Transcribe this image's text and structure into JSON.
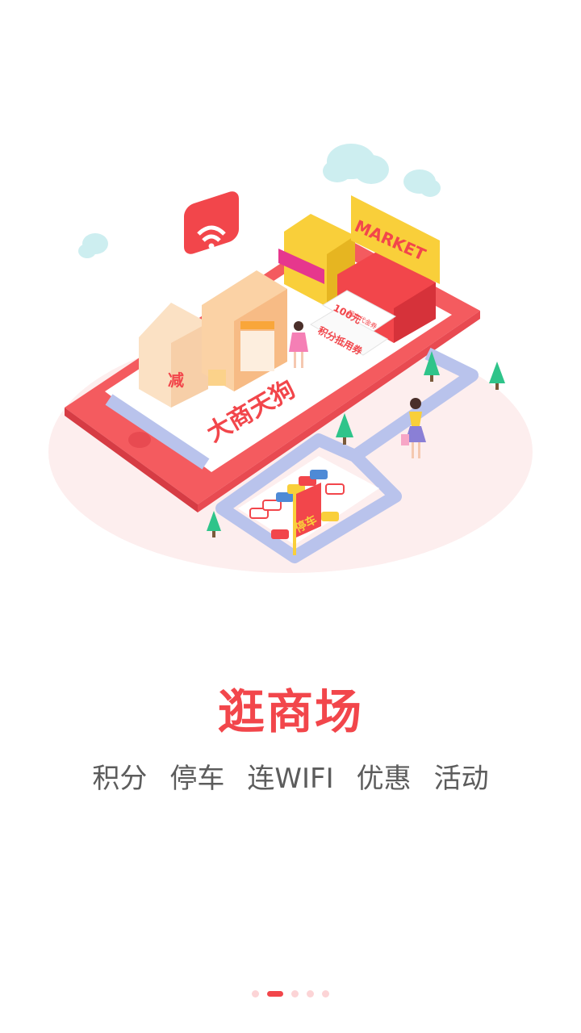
{
  "onboarding": {
    "illustration": {
      "signs": {
        "market": "MARKET",
        "store": "大商天狗",
        "discount": "减",
        "coupon_amount": "100元",
        "coupon_sub": "超市代金券",
        "coupon_points": "积分抵用券",
        "parking": "停车"
      },
      "icons": [
        "wifi-icon",
        "cloud-icon",
        "tree-icon",
        "car-icon",
        "shopper-icon"
      ]
    },
    "title": "逛商场",
    "features": [
      "积分",
      "停车",
      "连WIFI",
      "优惠",
      "活动"
    ],
    "pager": {
      "total": 5,
      "active_index": 1
    }
  },
  "colors": {
    "accent": "#f2464b",
    "feature_text": "#5c5c5c",
    "dot_active": "#f2464b",
    "dot_inactive": "#fcd4d6",
    "road": "#b9c3ec",
    "platform": "#f45b5f",
    "market_yellow": "#f9cf3a",
    "tree": "#2fc48a",
    "cloud": "#cdeef0"
  }
}
